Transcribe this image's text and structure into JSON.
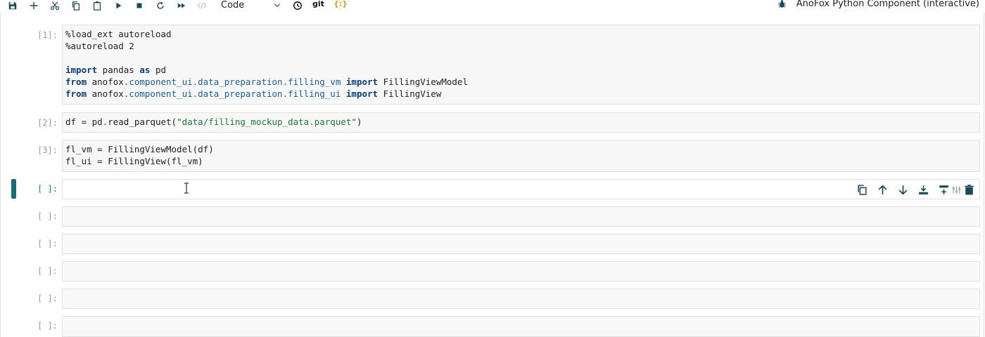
{
  "toolbar": {
    "cell_type": "Code",
    "git_label": "git",
    "braces_label": "{:}",
    "kernel_name": "AnoFox Python Component (interactive)"
  },
  "cells": [
    {
      "prompt": "[1]:",
      "lines": [
        "%load_ext autoreload",
        "%autoreload 2",
        "",
        "import pandas as pd",
        "from anofox.component_ui.data_preparation.filling_vm import FillingViewModel",
        "from anofox.component_ui.data_preparation.filling_ui import FillingView"
      ]
    },
    {
      "prompt": "[2]:",
      "lines": [
        "df = pd.read_parquet(\"data/filling_mockup_data.parquet\")"
      ]
    },
    {
      "prompt": "[3]:",
      "lines": [
        "fl_vm = FillingViewModel(df)",
        "fl_ui = FillingView(fl_vm)"
      ]
    },
    {
      "prompt": "[ ]:",
      "lines": []
    },
    {
      "prompt": "[ ]:",
      "lines": []
    },
    {
      "prompt": "[ ]:",
      "lines": []
    },
    {
      "prompt": "[ ]:",
      "lines": []
    },
    {
      "prompt": "[ ]:",
      "lines": []
    },
    {
      "prompt": "[ ]:",
      "lines": []
    }
  ],
  "colors": {
    "accent": "#1a6b7a",
    "keyword": "#0b3e7a",
    "string": "#1a7a3a"
  },
  "icons": [
    "save-icon",
    "add-icon",
    "cut-icon",
    "copy-icon",
    "paste-icon",
    "run-icon",
    "stop-icon",
    "restart-icon",
    "fast-forward-icon",
    "code-icon",
    "clock-icon",
    "bug-icon"
  ]
}
